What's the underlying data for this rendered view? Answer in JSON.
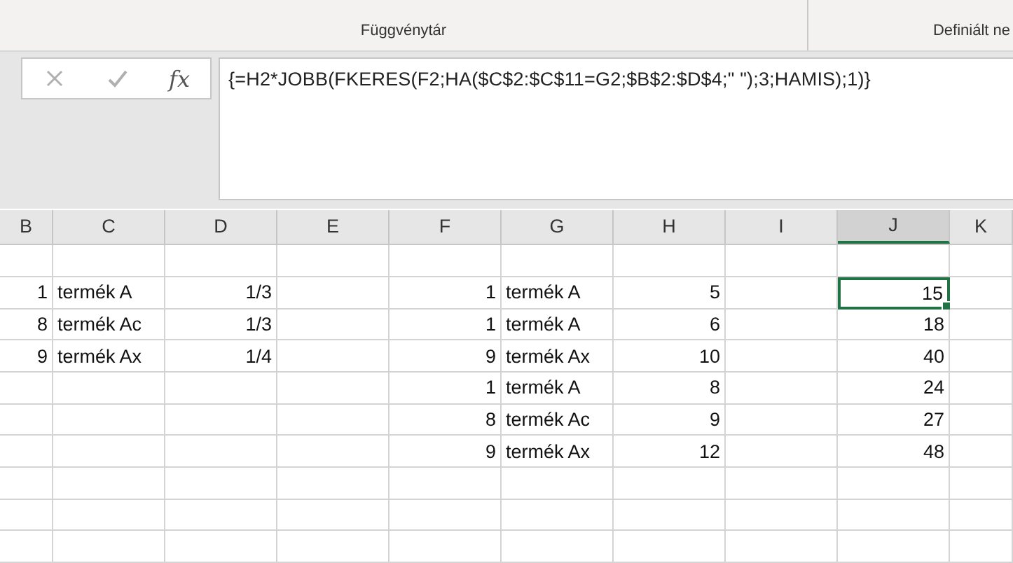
{
  "ribbon": {
    "groups": [
      {
        "label": "Függvénytár"
      },
      {
        "label": "Definiált ne"
      }
    ]
  },
  "formula_bar": {
    "function_label": "fx",
    "formula": "{=H2*JOBB(FKERES(F2;HA($C$2:$C$11=G2;$B$2:$D$4;\" \");3;HAMIS);1)}"
  },
  "columns": [
    {
      "label": "B",
      "selected": false
    },
    {
      "label": "C",
      "selected": false
    },
    {
      "label": "D",
      "selected": false
    },
    {
      "label": "E",
      "selected": false
    },
    {
      "label": "F",
      "selected": false
    },
    {
      "label": "G",
      "selected": false
    },
    {
      "label": "H",
      "selected": false
    },
    {
      "label": "I",
      "selected": false
    },
    {
      "label": "J",
      "selected": true
    },
    {
      "label": "K",
      "selected": false
    }
  ],
  "rows": [
    {},
    {
      "b": {
        "text": "1",
        "selected": false
      },
      "c": {
        "text": "termék A",
        "selected": false
      },
      "d": {
        "text": "1/3",
        "selected": false
      },
      "f": {
        "text": "1",
        "selected": false
      },
      "g": {
        "text": "termék A",
        "selected": false
      },
      "h": {
        "text": "5",
        "selected": false
      },
      "j": {
        "text": "15",
        "selected": true
      }
    },
    {
      "b": {
        "text": "8",
        "selected": false
      },
      "c": {
        "text": "termék Ac",
        "selected": false
      },
      "d": {
        "text": "1/3",
        "selected": false
      },
      "f": {
        "text": "1",
        "selected": false
      },
      "g": {
        "text": "termék A",
        "selected": false
      },
      "h": {
        "text": "6",
        "selected": false
      },
      "j": {
        "text": "18",
        "selected": false
      }
    },
    {
      "b": {
        "text": "9",
        "selected": false
      },
      "c": {
        "text": "termék Ax",
        "selected": false
      },
      "d": {
        "text": "1/4",
        "selected": false
      },
      "f": {
        "text": "9",
        "selected": false
      },
      "g": {
        "text": "termék Ax",
        "selected": false
      },
      "h": {
        "text": "10",
        "selected": false
      },
      "j": {
        "text": "40",
        "selected": false
      }
    },
    {
      "f": {
        "text": "1",
        "selected": false
      },
      "g": {
        "text": "termék A",
        "selected": false
      },
      "h": {
        "text": "8",
        "selected": false
      },
      "j": {
        "text": "24",
        "selected": false
      }
    },
    {
      "f": {
        "text": "8",
        "selected": false
      },
      "g": {
        "text": "termék Ac",
        "selected": false
      },
      "h": {
        "text": "9",
        "selected": false
      },
      "j": {
        "text": "27",
        "selected": false
      }
    },
    {
      "f": {
        "text": "9",
        "selected": false
      },
      "g": {
        "text": "termék Ax",
        "selected": false
      },
      "h": {
        "text": "12",
        "selected": false
      },
      "j": {
        "text": "48",
        "selected": false
      }
    },
    {},
    {},
    {}
  ]
}
